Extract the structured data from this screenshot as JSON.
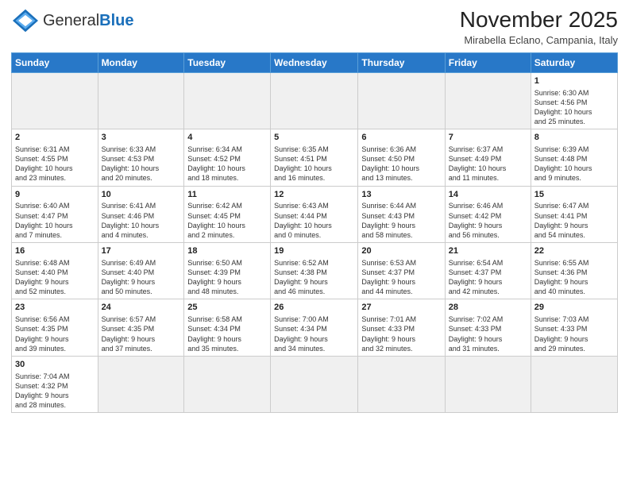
{
  "header": {
    "logo_general": "General",
    "logo_blue": "Blue",
    "month_title": "November 2025",
    "location": "Mirabella Eclano, Campania, Italy"
  },
  "weekdays": [
    "Sunday",
    "Monday",
    "Tuesday",
    "Wednesday",
    "Thursday",
    "Friday",
    "Saturday"
  ],
  "weeks": [
    [
      {
        "day": "",
        "info": ""
      },
      {
        "day": "",
        "info": ""
      },
      {
        "day": "",
        "info": ""
      },
      {
        "day": "",
        "info": ""
      },
      {
        "day": "",
        "info": ""
      },
      {
        "day": "",
        "info": ""
      },
      {
        "day": "1",
        "info": "Sunrise: 6:30 AM\nSunset: 4:56 PM\nDaylight: 10 hours\nand 25 minutes."
      }
    ],
    [
      {
        "day": "2",
        "info": "Sunrise: 6:31 AM\nSunset: 4:55 PM\nDaylight: 10 hours\nand 23 minutes."
      },
      {
        "day": "3",
        "info": "Sunrise: 6:33 AM\nSunset: 4:53 PM\nDaylight: 10 hours\nand 20 minutes."
      },
      {
        "day": "4",
        "info": "Sunrise: 6:34 AM\nSunset: 4:52 PM\nDaylight: 10 hours\nand 18 minutes."
      },
      {
        "day": "5",
        "info": "Sunrise: 6:35 AM\nSunset: 4:51 PM\nDaylight: 10 hours\nand 16 minutes."
      },
      {
        "day": "6",
        "info": "Sunrise: 6:36 AM\nSunset: 4:50 PM\nDaylight: 10 hours\nand 13 minutes."
      },
      {
        "day": "7",
        "info": "Sunrise: 6:37 AM\nSunset: 4:49 PM\nDaylight: 10 hours\nand 11 minutes."
      },
      {
        "day": "8",
        "info": "Sunrise: 6:39 AM\nSunset: 4:48 PM\nDaylight: 10 hours\nand 9 minutes."
      }
    ],
    [
      {
        "day": "9",
        "info": "Sunrise: 6:40 AM\nSunset: 4:47 PM\nDaylight: 10 hours\nand 7 minutes."
      },
      {
        "day": "10",
        "info": "Sunrise: 6:41 AM\nSunset: 4:46 PM\nDaylight: 10 hours\nand 4 minutes."
      },
      {
        "day": "11",
        "info": "Sunrise: 6:42 AM\nSunset: 4:45 PM\nDaylight: 10 hours\nand 2 minutes."
      },
      {
        "day": "12",
        "info": "Sunrise: 6:43 AM\nSunset: 4:44 PM\nDaylight: 10 hours\nand 0 minutes."
      },
      {
        "day": "13",
        "info": "Sunrise: 6:44 AM\nSunset: 4:43 PM\nDaylight: 9 hours\nand 58 minutes."
      },
      {
        "day": "14",
        "info": "Sunrise: 6:46 AM\nSunset: 4:42 PM\nDaylight: 9 hours\nand 56 minutes."
      },
      {
        "day": "15",
        "info": "Sunrise: 6:47 AM\nSunset: 4:41 PM\nDaylight: 9 hours\nand 54 minutes."
      }
    ],
    [
      {
        "day": "16",
        "info": "Sunrise: 6:48 AM\nSunset: 4:40 PM\nDaylight: 9 hours\nand 52 minutes."
      },
      {
        "day": "17",
        "info": "Sunrise: 6:49 AM\nSunset: 4:40 PM\nDaylight: 9 hours\nand 50 minutes."
      },
      {
        "day": "18",
        "info": "Sunrise: 6:50 AM\nSunset: 4:39 PM\nDaylight: 9 hours\nand 48 minutes."
      },
      {
        "day": "19",
        "info": "Sunrise: 6:52 AM\nSunset: 4:38 PM\nDaylight: 9 hours\nand 46 minutes."
      },
      {
        "day": "20",
        "info": "Sunrise: 6:53 AM\nSunset: 4:37 PM\nDaylight: 9 hours\nand 44 minutes."
      },
      {
        "day": "21",
        "info": "Sunrise: 6:54 AM\nSunset: 4:37 PM\nDaylight: 9 hours\nand 42 minutes."
      },
      {
        "day": "22",
        "info": "Sunrise: 6:55 AM\nSunset: 4:36 PM\nDaylight: 9 hours\nand 40 minutes."
      }
    ],
    [
      {
        "day": "23",
        "info": "Sunrise: 6:56 AM\nSunset: 4:35 PM\nDaylight: 9 hours\nand 39 minutes."
      },
      {
        "day": "24",
        "info": "Sunrise: 6:57 AM\nSunset: 4:35 PM\nDaylight: 9 hours\nand 37 minutes."
      },
      {
        "day": "25",
        "info": "Sunrise: 6:58 AM\nSunset: 4:34 PM\nDaylight: 9 hours\nand 35 minutes."
      },
      {
        "day": "26",
        "info": "Sunrise: 7:00 AM\nSunset: 4:34 PM\nDaylight: 9 hours\nand 34 minutes."
      },
      {
        "day": "27",
        "info": "Sunrise: 7:01 AM\nSunset: 4:33 PM\nDaylight: 9 hours\nand 32 minutes."
      },
      {
        "day": "28",
        "info": "Sunrise: 7:02 AM\nSunset: 4:33 PM\nDaylight: 9 hours\nand 31 minutes."
      },
      {
        "day": "29",
        "info": "Sunrise: 7:03 AM\nSunset: 4:33 PM\nDaylight: 9 hours\nand 29 minutes."
      }
    ],
    [
      {
        "day": "30",
        "info": "Sunrise: 7:04 AM\nSunset: 4:32 PM\nDaylight: 9 hours\nand 28 minutes."
      },
      {
        "day": "",
        "info": ""
      },
      {
        "day": "",
        "info": ""
      },
      {
        "day": "",
        "info": ""
      },
      {
        "day": "",
        "info": ""
      },
      {
        "day": "",
        "info": ""
      },
      {
        "day": "",
        "info": ""
      }
    ]
  ]
}
